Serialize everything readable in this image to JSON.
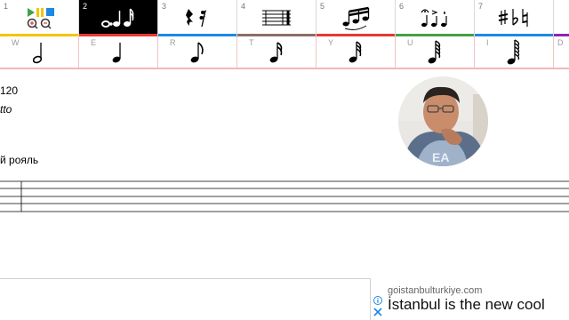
{
  "palette": {
    "groups": [
      {
        "num": "1",
        "icon": "playback-zoom-icon",
        "color": "#f5c400"
      },
      {
        "num": "2",
        "icon": "notes-dots-icon",
        "color": "#e53935",
        "active": true
      },
      {
        "num": "3",
        "icon": "rests-icon",
        "color": "#1e88e5"
      },
      {
        "num": "4",
        "icon": "measure-bars-icon",
        "color": "#8d6e63"
      },
      {
        "num": "5",
        "icon": "beams-tuplets-icon",
        "color": "#e53935"
      },
      {
        "num": "6",
        "icon": "articulations-icon",
        "color": "#43a047"
      },
      {
        "num": "7",
        "icon": "accidentals-icon",
        "color": "#1e88e5"
      },
      {
        "num": "",
        "icon": "",
        "color": "#8e24aa"
      }
    ],
    "durations": [
      {
        "key": "W",
        "icon": "half-note-icon"
      },
      {
        "key": "E",
        "icon": "quarter-note-icon"
      },
      {
        "key": "R",
        "icon": "eighth-note-icon"
      },
      {
        "key": "T",
        "icon": "sixteenth-note-icon"
      },
      {
        "key": "Y",
        "icon": "thirty-second-note-icon"
      },
      {
        "key": "U",
        "icon": "sixty-fourth-note-icon"
      },
      {
        "key": "I",
        "icon": "hundred-twenty-eighth-note-icon"
      },
      {
        "key": "D",
        "icon": ""
      }
    ]
  },
  "score": {
    "tempo": "120",
    "expression": "tto",
    "instrument": "й рояль"
  },
  "ad": {
    "domain": "goistanbulturkiye.com",
    "headline": "İstanbul is the new cool"
  },
  "icons": {
    "info": "ad-info-icon",
    "close": "ad-close-icon"
  }
}
